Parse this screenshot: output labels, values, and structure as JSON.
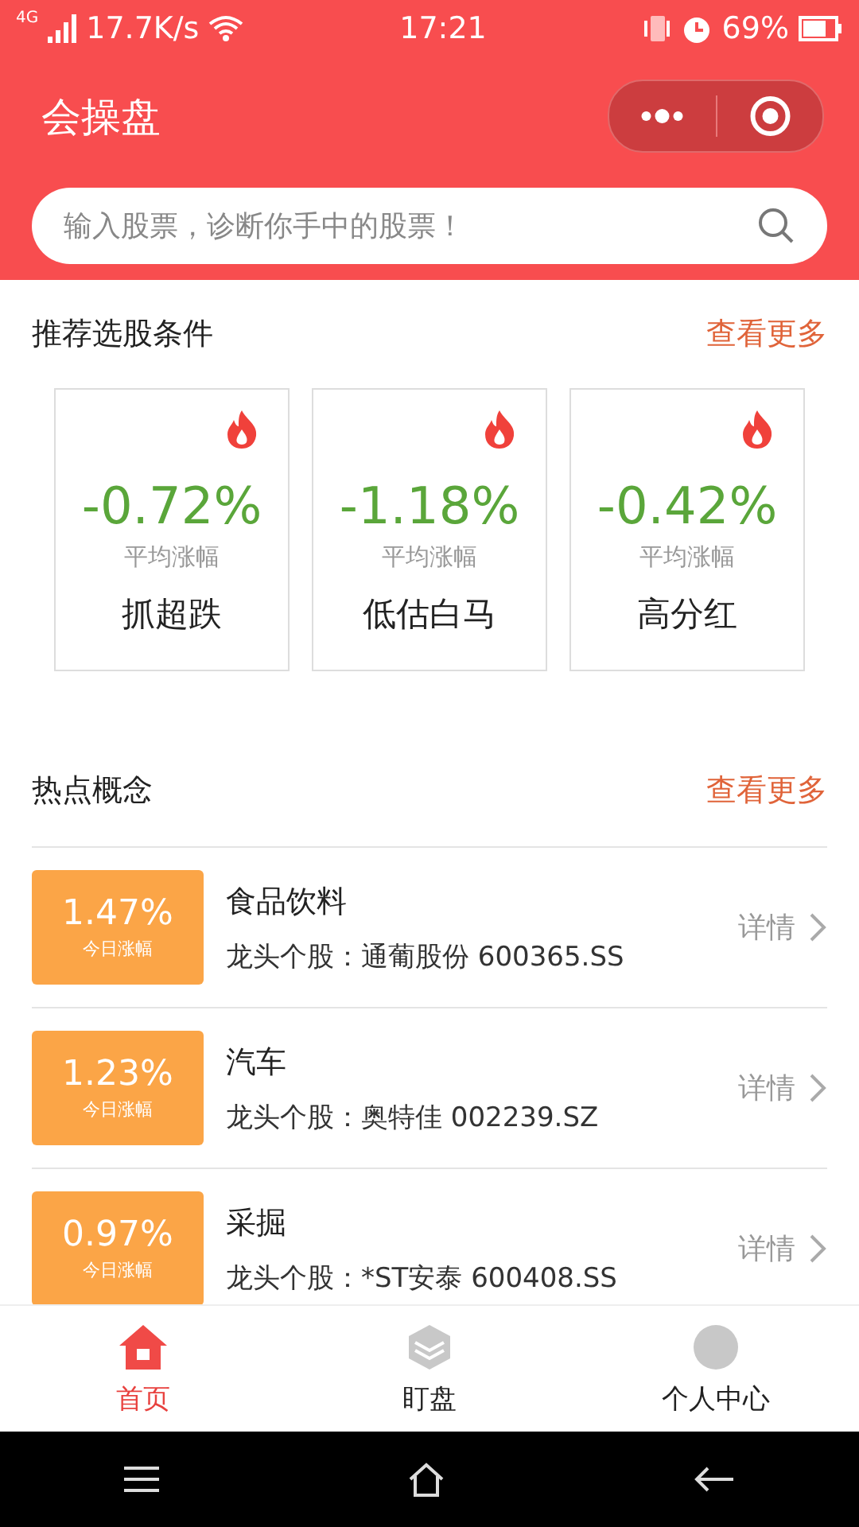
{
  "status_bar": {
    "network": "4G",
    "speed": "17.7K/s",
    "time": "17:21",
    "battery": "69%"
  },
  "header": {
    "title": "会操盘"
  },
  "search": {
    "placeholder": "输入股票，诊断你手中的股票！"
  },
  "conditions": {
    "title": "推荐选股条件",
    "more": "查看更多",
    "cards": [
      {
        "change": "-0.72%",
        "caption": "平均涨幅",
        "name": "抓超跌"
      },
      {
        "change": "-1.18%",
        "caption": "平均涨幅",
        "name": "低估白马"
      },
      {
        "change": "-0.42%",
        "caption": "平均涨幅",
        "name": "高分红"
      }
    ]
  },
  "concepts": {
    "title": "热点概念",
    "more": "查看更多",
    "rows": [
      {
        "change": "1.47%",
        "caption": "今日涨幅",
        "name": "食品饮料",
        "leader": "龙头个股：通葡股份 600365.SS",
        "detail": "详情"
      },
      {
        "change": "1.23%",
        "caption": "今日涨幅",
        "name": "汽车",
        "leader": "龙头个股：奥特佳 002239.SZ",
        "detail": "详情"
      },
      {
        "change": "0.97%",
        "caption": "今日涨幅",
        "name": "采掘",
        "leader": "龙头个股：*ST安泰 600408.SS",
        "detail": "详情"
      }
    ]
  },
  "tabs": [
    {
      "label": "首页",
      "selected": true,
      "kind": "home"
    },
    {
      "label": "盯盘",
      "selected": false,
      "kind": "market"
    },
    {
      "label": "个人中心",
      "selected": false,
      "kind": "profile"
    }
  ]
}
